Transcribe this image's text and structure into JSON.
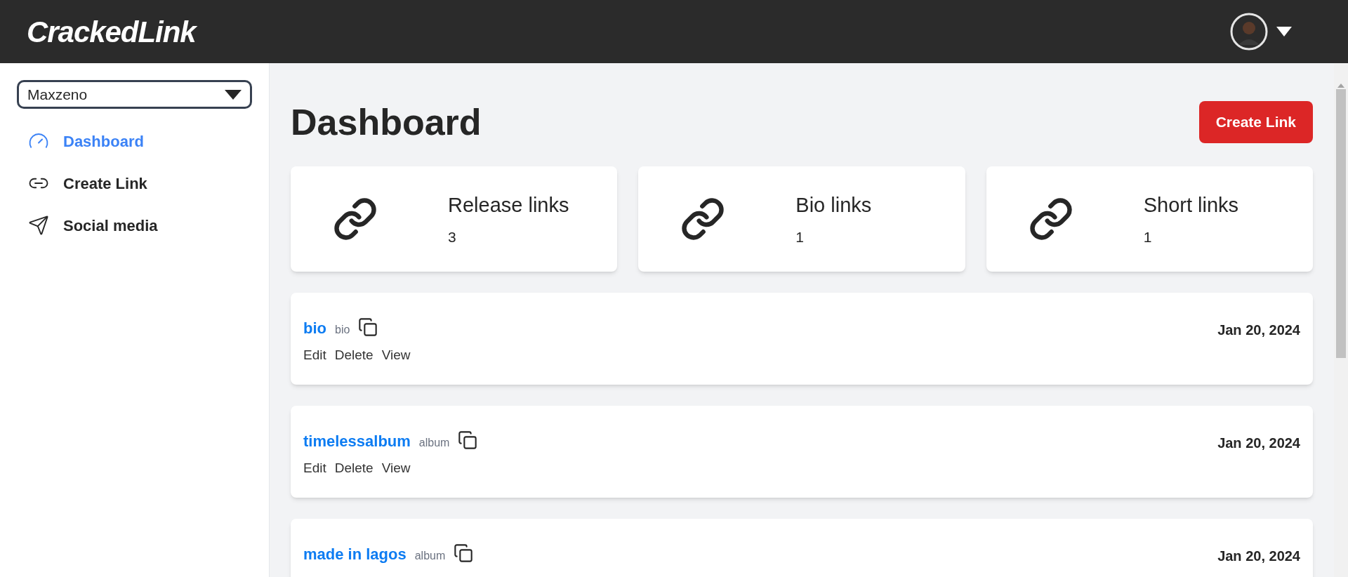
{
  "header": {
    "logo": "CrackedLink"
  },
  "sidebar": {
    "account_select": {
      "value": "Maxzeno"
    },
    "items": [
      {
        "label": "Dashboard",
        "selected": true
      },
      {
        "label": "Create Link",
        "selected": false
      },
      {
        "label": "Social media",
        "selected": false
      }
    ]
  },
  "main": {
    "title": "Dashboard",
    "create_button": "Create Link",
    "stats": [
      {
        "label": "Release links",
        "count": "3"
      },
      {
        "label": "Bio links",
        "count": "1"
      },
      {
        "label": "Short links",
        "count": "1"
      }
    ],
    "links": [
      {
        "name": "bio",
        "type": "bio",
        "date": "Jan 20, 2024",
        "actions": [
          "Edit",
          "Delete",
          "View"
        ]
      },
      {
        "name": "timelessalbum",
        "type": "album",
        "date": "Jan 20, 2024",
        "actions": [
          "Edit",
          "Delete",
          "View"
        ]
      },
      {
        "name": "made in lagos",
        "type": "album",
        "date": "Jan 20, 2024"
      }
    ]
  }
}
